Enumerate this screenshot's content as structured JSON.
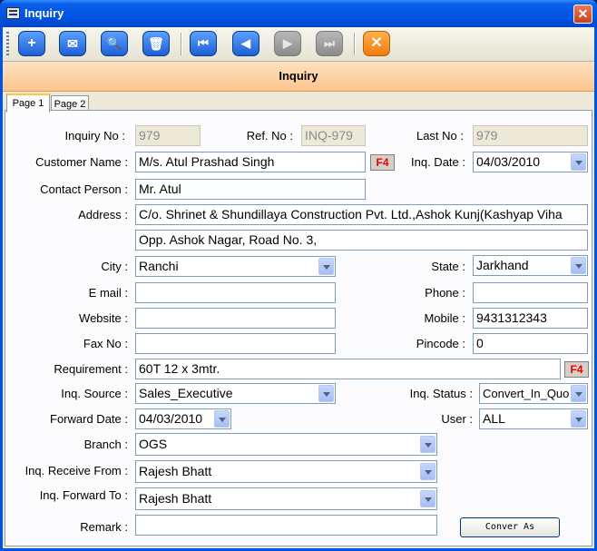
{
  "window": {
    "title": "Inquiry",
    "close": "✕"
  },
  "toolbar": {
    "add": "+",
    "mail": "✉",
    "search": "🔍",
    "delete": "🗑",
    "first": "⏮",
    "prev": "◀",
    "next": "▶",
    "last": "⏭",
    "close": "✕"
  },
  "banner": "Inquiry",
  "tabs": [
    "Page 1",
    "Page 2"
  ],
  "labels": {
    "inquiry_no": "Inquiry No :",
    "ref_no": "Ref. No :",
    "last_no": "Last No :",
    "customer_name": "Customer Name :",
    "inq_date": "Inq. Date :",
    "contact_person": "Contact Person :",
    "address": "Address :",
    "city": "City :",
    "state": "State :",
    "email": "E mail :",
    "phone": "Phone :",
    "website": "Website :",
    "mobile": "Mobile :",
    "fax": "Fax No :",
    "pincode": "Pincode :",
    "requirement": "Requirement :",
    "inq_source": "Inq. Source :",
    "inq_status": "Inq. Status :",
    "forward_date": "Forward Date :",
    "user": "User :",
    "branch": "Branch :",
    "receive_from": "Inq. Receive From :",
    "forward_to": "Inq. Forward To :",
    "remark": "Remark :"
  },
  "values": {
    "inquiry_no": "979",
    "ref_no": "INQ-979",
    "last_no": "979",
    "customer_name": "M/s. Atul Prashad Singh",
    "inq_date": "04/03/2010",
    "contact_person": "Mr. Atul",
    "address1": "C/o. Shrinet & Shundillaya Construction Pvt. Ltd.,Ashok Kunj(Kashyap Viha",
    "address2": "Opp. Ashok Nagar, Road No. 3,",
    "city": "Ranchi",
    "state": "Jarkhand",
    "email": "",
    "phone": "",
    "website": "",
    "mobile": "9431312343",
    "fax": "",
    "pincode": "0",
    "requirement": "60T 12 x 3mtr.",
    "inq_source": "Sales_Executive",
    "inq_status": "Convert_In_Quo",
    "forward_date": "04/03/2010",
    "user": "ALL",
    "branch": "OGS",
    "receive_from": "Rajesh Bhatt",
    "forward_to": "Rajesh Bhatt",
    "remark": ""
  },
  "f4": "F4",
  "convert_button": "Conver As"
}
